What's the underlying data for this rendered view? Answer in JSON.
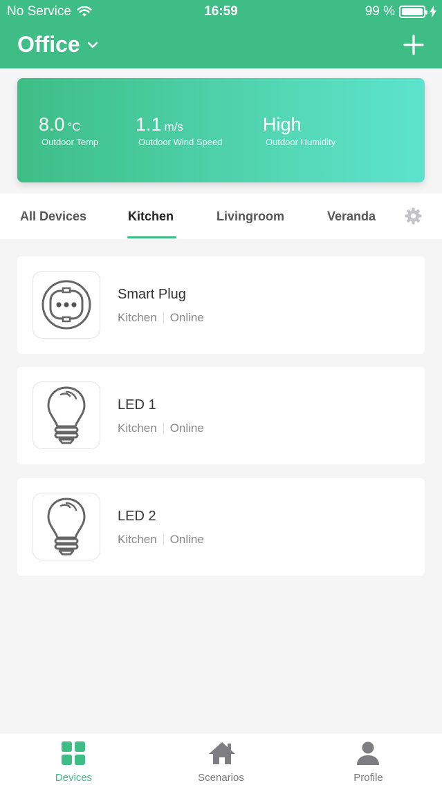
{
  "status_bar": {
    "carrier": "No Service",
    "time": "16:59",
    "battery_percent": "99 %",
    "battery_level": 0.99
  },
  "header": {
    "title": "Office",
    "title_icon": "chevron-down-icon",
    "action_icon": "plus-icon"
  },
  "weather": {
    "temp_value": "8.0",
    "temp_unit": "°C",
    "temp_label": "Outdoor Temp",
    "wind_value": "1.1",
    "wind_unit": "m/s",
    "wind_label": "Outdoor Wind Speed",
    "humidity_value": "High",
    "humidity_label": "Outdoor Humidity"
  },
  "tabs": [
    {
      "label": "All Devices",
      "active": false
    },
    {
      "label": "Kitchen",
      "active": true
    },
    {
      "label": "Livingroom",
      "active": false
    },
    {
      "label": "Veranda",
      "active": false
    }
  ],
  "devices": [
    {
      "name": "Smart Plug",
      "room": "Kitchen",
      "status": "Online",
      "icon": "smart-plug-icon"
    },
    {
      "name": "LED 1",
      "room": "Kitchen",
      "status": "Online",
      "icon": "light-bulb-icon"
    },
    {
      "name": "LED 2",
      "room": "Kitchen",
      "status": "Online",
      "icon": "light-bulb-icon"
    }
  ],
  "tab_bar": [
    {
      "label": "Devices",
      "icon": "grid-icon",
      "active": true
    },
    {
      "label": "Scenarios",
      "icon": "home-icon",
      "active": false
    },
    {
      "label": "Profile",
      "icon": "person-icon",
      "active": false
    }
  ],
  "colors": {
    "accent": "#3ebd86",
    "gradient_end": "#5ce3cd",
    "background": "#f5f5f6"
  }
}
